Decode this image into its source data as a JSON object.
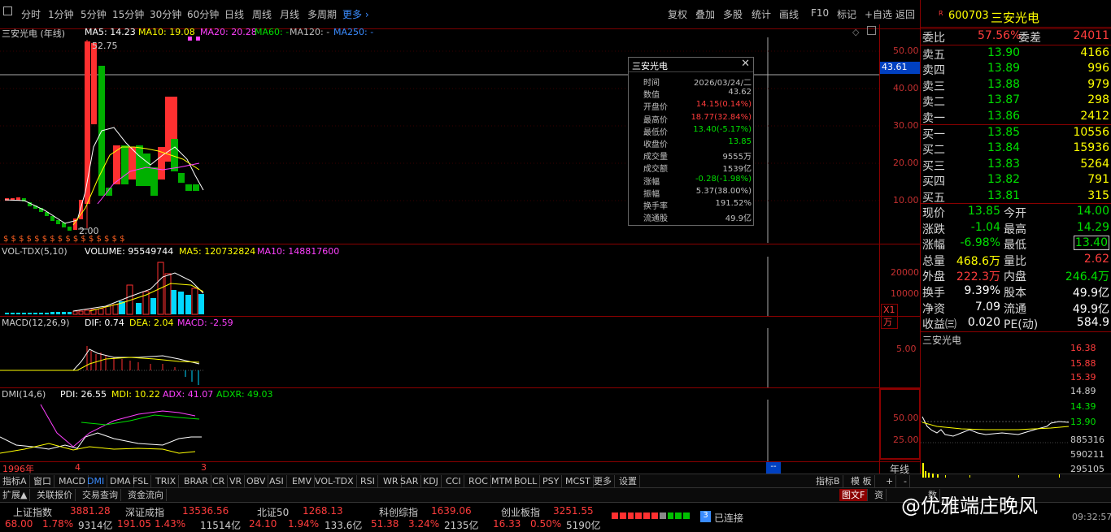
{
  "topbar": {
    "periods": [
      "分时",
      "1分钟",
      "5分钟",
      "15分钟",
      "30分钟",
      "60分钟",
      "日线",
      "周线",
      "月线",
      "多周期"
    ],
    "more": "更多",
    "tools": [
      "复权",
      "叠加",
      "多股",
      "统计",
      "画线",
      "F10",
      "标记",
      "+自选",
      "返回"
    ]
  },
  "chart": {
    "title": "三安光电 (年线)",
    "ma_legend": [
      {
        "label": "MA5: 14.23",
        "color": "#ffffff"
      },
      {
        "label": "MA10: 19.08",
        "color": "#ffff00"
      },
      {
        "label": "MA20: 20.28",
        "color": "#ff40ff"
      },
      {
        "label": "MA60: -",
        "color": "#00e000"
      },
      {
        "label": "MA120: -",
        "color": "#c0c0c0"
      },
      {
        "label": "MA250: -",
        "color": "#3a8cff"
      }
    ],
    "high_label": "52.75",
    "low_label": "2.00",
    "cursor_price": "43.61",
    "y_ticks": [
      "50.00",
      "40.00",
      "30.00",
      "20.00",
      "10.00"
    ],
    "s_markers": "$ $ $ $ $ $ $ $ $ $ $ $ $ $ $ $"
  },
  "volume": {
    "title": "VOL-TDX(5,10)",
    "volume": "VOLUME: 95549744",
    "ma5": "MA5: 120732824",
    "ma10": "MA10: 148817600",
    "y_ticks": [
      "20000",
      "10000"
    ],
    "unit": "X1万"
  },
  "macd": {
    "title": "MACD(12,26,9)",
    "dif": "DIF: 0.74",
    "dea": "DEA: 2.04",
    "macd": "MACD: -2.59",
    "y_ticks": [
      "5.00"
    ]
  },
  "dmi": {
    "title": "DMI(14,6)",
    "pdi": "PDI: 26.55",
    "mdi": "MDI: 10.22",
    "adx": "ADX: 41.07",
    "adxr": "ADXR: 49.03",
    "y_ticks": [
      "50.00",
      "25.00"
    ]
  },
  "xaxis": {
    "start": "1996年",
    "mid": "4",
    "end": "3",
    "label": "年线"
  },
  "popup": {
    "title": "三安光电",
    "rows": [
      {
        "k": "时间",
        "v": "2026/03/24/二",
        "c": "#c0c0c0"
      },
      {
        "k": "数值",
        "v": "43.62",
        "c": "#c0c0c0"
      },
      {
        "k": "开盘价",
        "v": "14.15(0.14%)",
        "c": "#ff3c3c"
      },
      {
        "k": "最高价",
        "v": "18.77(32.84%)",
        "c": "#ff3c3c"
      },
      {
        "k": "最低价",
        "v": "13.40(-5.17%)",
        "c": "#00e000"
      },
      {
        "k": "收盘价",
        "v": "13.85",
        "c": "#00e000"
      },
      {
        "k": "成交量",
        "v": "9555万",
        "c": "#c0c0c0"
      },
      {
        "k": "成交额",
        "v": "1539亿",
        "c": "#c0c0c0"
      },
      {
        "k": "涨幅",
        "v": "-0.28(-1.98%)",
        "c": "#00e000"
      },
      {
        "k": "振幅",
        "v": "5.37(38.00%)",
        "c": "#c0c0c0"
      },
      {
        "k": "换手率",
        "v": "191.52%",
        "c": "#c0c0c0"
      },
      {
        "k": "流通股",
        "v": "49.9亿",
        "c": "#c0c0c0"
      }
    ]
  },
  "tabs": [
    "指标A",
    "窗口",
    "MACD",
    "DMI",
    "DMA",
    "FSL",
    "TRIX",
    "BRAR",
    "CR",
    "VR",
    "OBV",
    "ASI",
    "EMV",
    "VOL-TDX",
    "RSI",
    "WR",
    "SAR",
    "KDJ",
    "CCI",
    "ROC",
    "MTM",
    "BOLL",
    "PSY",
    "MCST",
    "更多",
    "设置"
  ],
  "tabs_right": [
    "指标B",
    "模 板",
    "+",
    "-"
  ],
  "bottom_tabs": [
    "扩展▲",
    "关联报价",
    "交易查询",
    "资金流向"
  ],
  "bottom_right": [
    "图文F",
    "资",
    "数"
  ],
  "quote": {
    "code": "600703",
    "name": "三安光电",
    "wb": {
      "k1": "委比",
      "v1": "57.56%",
      "k2": "委差",
      "v2": "24011"
    },
    "sells": [
      {
        "k": "卖五",
        "p": "13.90",
        "v": "4166"
      },
      {
        "k": "卖四",
        "p": "13.89",
        "v": "996"
      },
      {
        "k": "卖三",
        "p": "13.88",
        "v": "979"
      },
      {
        "k": "卖二",
        "p": "13.87",
        "v": "298"
      },
      {
        "k": "卖一",
        "p": "13.86",
        "v": "2412"
      }
    ],
    "buys": [
      {
        "k": "买一",
        "p": "13.85",
        "v": "10556"
      },
      {
        "k": "买二",
        "p": "13.84",
        "v": "15936"
      },
      {
        "k": "买三",
        "p": "13.83",
        "v": "5264"
      },
      {
        "k": "买四",
        "p": "13.82",
        "v": "791"
      },
      {
        "k": "买五",
        "p": "13.81",
        "v": "315"
      }
    ],
    "stats": [
      {
        "k1": "现价",
        "v1": "13.85",
        "c1": "#00e000",
        "k2": "今开",
        "v2": "14.00",
        "c2": "#00e000"
      },
      {
        "k1": "涨跌",
        "v1": "-1.04",
        "c1": "#00e000",
        "k2": "最高",
        "v2": "14.29",
        "c2": "#00e000"
      },
      {
        "k1": "涨幅",
        "v1": "-6.98%",
        "c1": "#00e000",
        "k2": "最低",
        "v2": "13.40",
        "c2": "#00e000"
      },
      {
        "k1": "总量",
        "v1": "468.6万",
        "c1": "#ffff00",
        "k2": "量比",
        "v2": "2.62",
        "c2": "#ff3c3c"
      },
      {
        "k1": "外盘",
        "v1": "222.3万",
        "c1": "#ff3c3c",
        "k2": "内盘",
        "v2": "246.4万",
        "c2": "#00e000"
      },
      {
        "k1": "换手",
        "v1": "9.39%",
        "c1": "#ffffff",
        "k2": "股本",
        "v2": "49.9亿",
        "c2": "#ffffff"
      },
      {
        "k1": "净资",
        "v1": "7.09",
        "c1": "#ffffff",
        "k2": "流通",
        "v2": "49.9亿",
        "c2": "#ffffff"
      },
      {
        "k1": "收益㈢",
        "v1": "0.020",
        "c1": "#ffffff",
        "k2": "PE(动)",
        "v2": "584.9",
        "c2": "#ffffff"
      }
    ],
    "mini_title": "三安光电",
    "mini_ticks": [
      "16.38",
      "15.88",
      "15.39",
      "14.89",
      "14.39",
      "13.90",
      "885316",
      "590211",
      "295105"
    ]
  },
  "status": {
    "indices": [
      {
        "name": "上证指数",
        "val": "3881.28",
        "chg": "68.00",
        "pct": "1.78%",
        "amt": "9314亿"
      },
      {
        "name": "深证成指",
        "val": "13536.56",
        "chg": "191.05",
        "pct": "1.43%",
        "amt": "11514亿"
      },
      {
        "name": "北证50",
        "val": "1268.13",
        "chg": "24.10",
        "pct": "1.94%",
        "amt": "133.6亿"
      },
      {
        "name": "科创综指",
        "val": "1639.06",
        "chg": "51.38",
        "pct": "3.24%",
        "amt": "2135亿"
      },
      {
        "name": "创业板指",
        "val": "3251.55",
        "chg": "16.33",
        "pct": "0.50%",
        "amt": "5190亿"
      }
    ],
    "conn_num": "3",
    "conn": "已连接",
    "watermark": "@优雅端庄晚风",
    "time": "09:32:57"
  }
}
